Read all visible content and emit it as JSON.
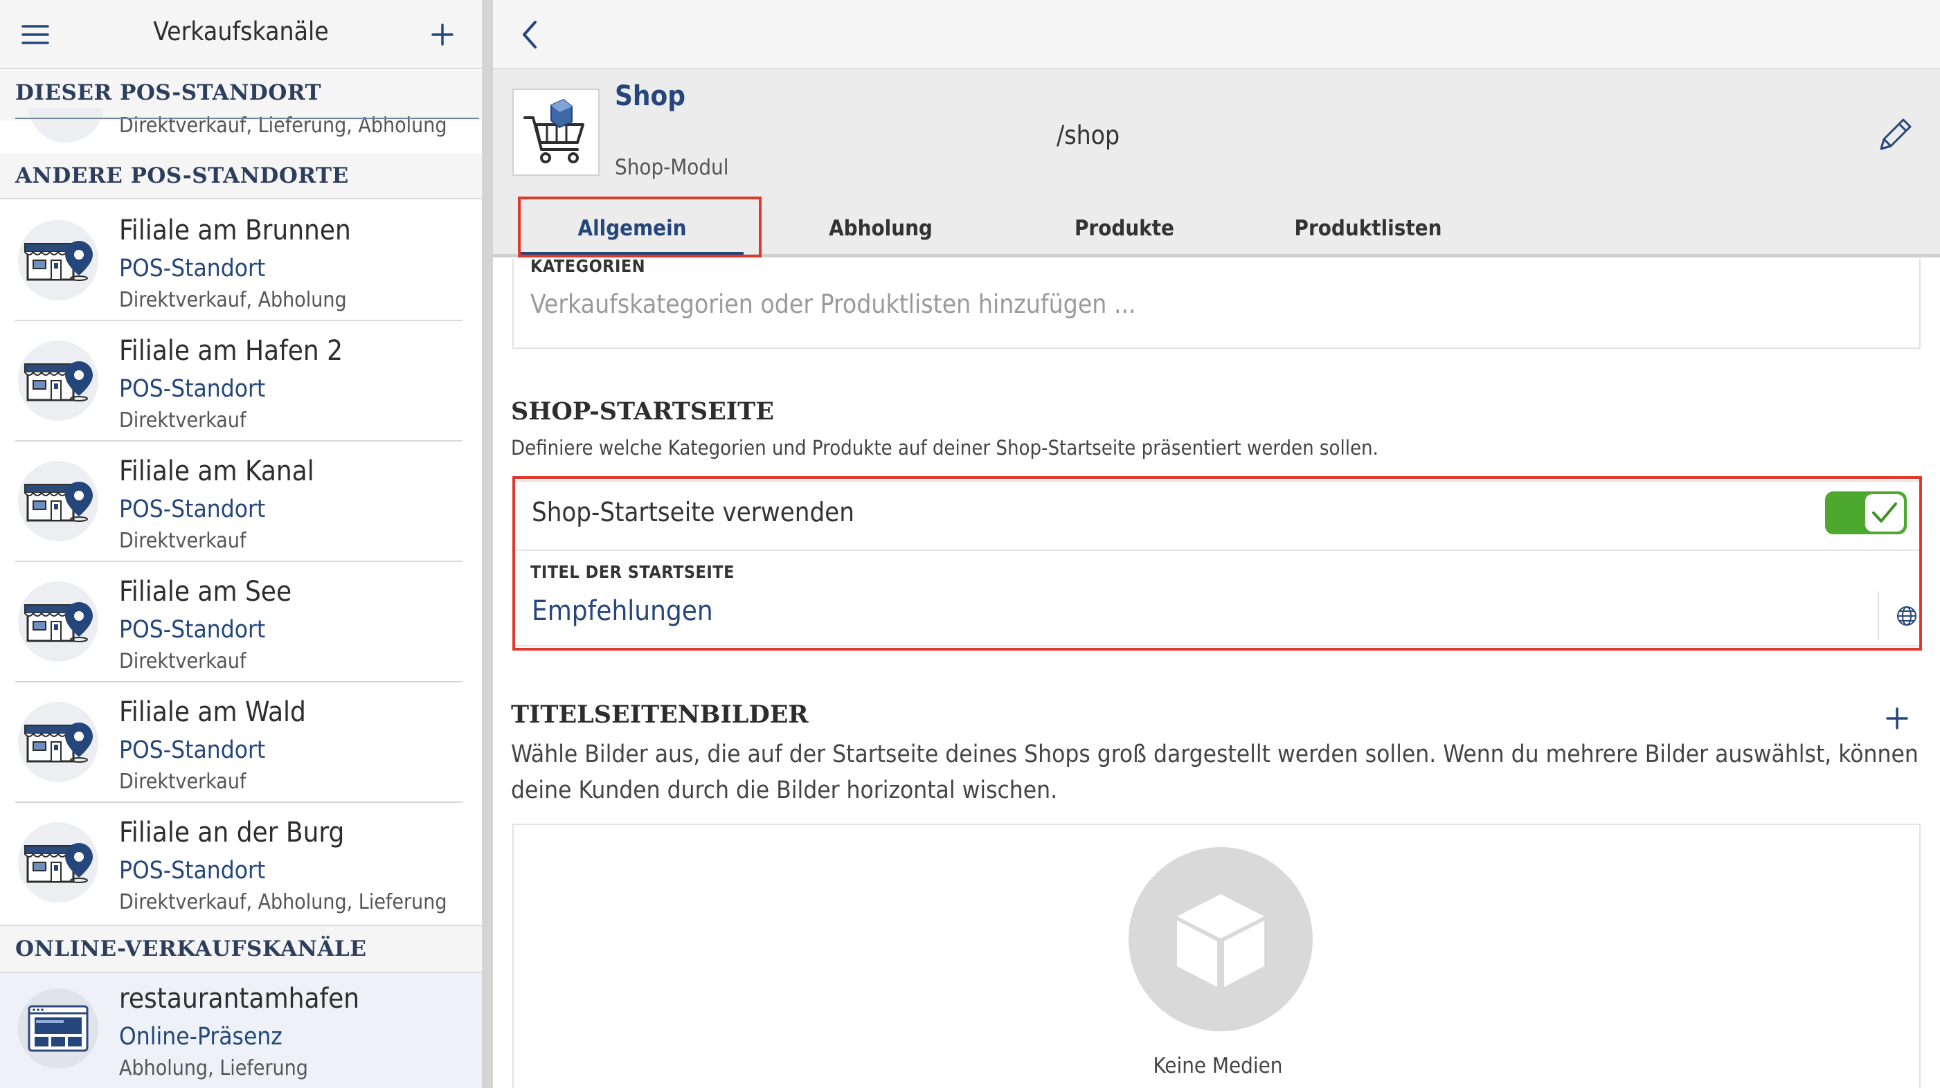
{
  "left_header": {
    "title": "Verkaufskanäle"
  },
  "sections": {
    "this_pos": "DIESER POS-STANDORT",
    "this_pos_sub": "Direktverkauf, Lieferung, Abholung",
    "other_pos": "ANDERE POS-STANDORTE",
    "online": "ONLINE-VERKAUFSKANÄLE"
  },
  "locations": [
    {
      "name": "Filiale am Brunnen",
      "type": "POS-Standort",
      "modes": "Direktverkauf, Abholung"
    },
    {
      "name": "Filiale am Hafen 2",
      "type": "POS-Standort",
      "modes": "Direktverkauf"
    },
    {
      "name": "Filiale am Kanal",
      "type": "POS-Standort",
      "modes": "Direktverkauf"
    },
    {
      "name": "Filiale am See",
      "type": "POS-Standort",
      "modes": "Direktverkauf"
    },
    {
      "name": "Filiale am Wald",
      "type": "POS-Standort",
      "modes": "Direktverkauf"
    },
    {
      "name": "Filiale an der Burg",
      "type": "POS-Standort",
      "modes": "Direktverkauf, Abholung, Lieferung"
    }
  ],
  "online_channel": {
    "name": "restaurantamhafen",
    "type": "Online-Präsenz",
    "modes": "Abholung, Lieferung"
  },
  "module": {
    "title": "Shop",
    "subtitle": "Shop-Modul",
    "path": "/shop"
  },
  "tabs": [
    "Allgemein",
    "Abholung",
    "Produkte",
    "Produktlisten"
  ],
  "categories": {
    "label": "KATEGORIEN",
    "placeholder": "Verkaufskategorien oder Produktlisten hinzufügen ..."
  },
  "shop_start": {
    "title": "SHOP-STARTSEITE",
    "description": "Definiere welche Kategorien und Produkte auf deiner Shop-Startseite präsentiert werden sollen.",
    "toggle_label": "Shop-Startseite verwenden",
    "toggle_on": true,
    "title_field_label": "TITEL DER STARTSEITE",
    "title_field_value": "Empfehlungen"
  },
  "title_images": {
    "title": "TITELSEITENBILDER",
    "description_line1": "Wähle Bilder aus, die auf der Startseite deines Shops groß dargestellt werden sollen. Wenn du mehrere Bilder auswählst, können",
    "description_line2": "deine Kunden durch die Bilder horizontal wischen.",
    "empty_label": "Keine Medien"
  },
  "colors": {
    "accent": "#24467a",
    "toggle_green": "#4ca82f",
    "highlight_red": "#e0392b"
  }
}
